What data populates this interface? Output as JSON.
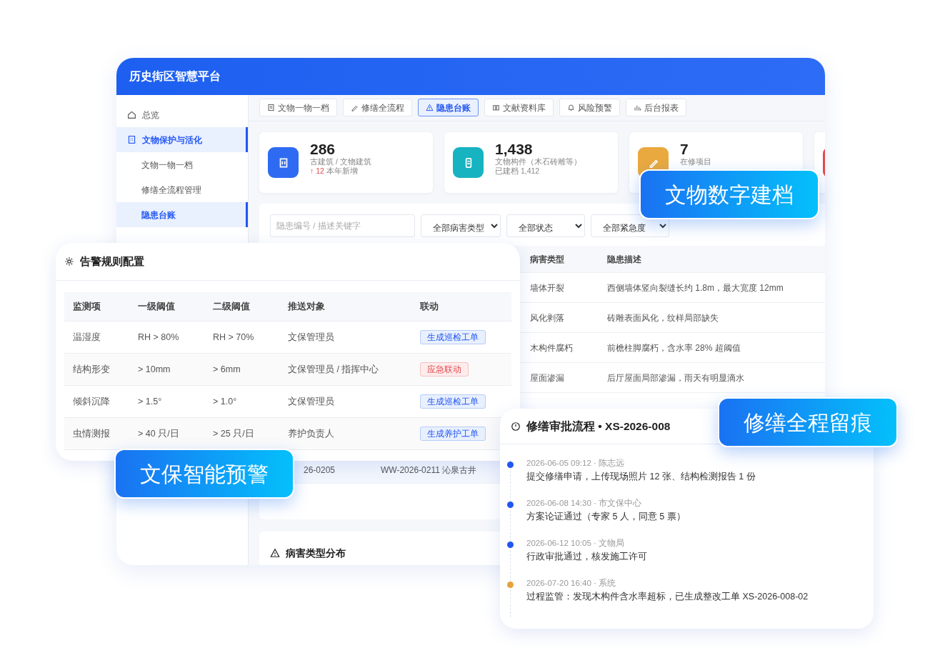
{
  "window": {
    "title": "历史街区智慧平台"
  },
  "sidebar": {
    "items": [
      {
        "label": "总览",
        "kind": "top",
        "selected": false
      },
      {
        "label": "文物保护与活化",
        "kind": "group",
        "selected": true
      },
      {
        "label": "文物一物一档",
        "kind": "sub",
        "selected": false
      },
      {
        "label": "修缮全流程管理",
        "kind": "sub",
        "selected": false
      },
      {
        "label": "隐患台账",
        "kind": "sub",
        "selected": true
      }
    ]
  },
  "tabs": [
    {
      "label": "文物一物一档",
      "selected": false
    },
    {
      "label": "修缮全流程",
      "selected": false
    },
    {
      "label": "隐患台账",
      "selected": true
    },
    {
      "label": "文献资料库",
      "selected": false
    },
    {
      "label": "风险预警",
      "selected": false
    },
    {
      "label": "后台报表",
      "selected": false
    }
  ],
  "stats": [
    {
      "value": "286",
      "label": "古建筑 / 文物建筑",
      "delta": "↑ 12",
      "note": "本年新增",
      "color": "#2f6bf2"
    },
    {
      "value": "1,438",
      "label": "文物构件（木石砖雕等）",
      "note": "已建档 1,412",
      "color": "#17b3c1"
    },
    {
      "value": "7",
      "label": "在修项目",
      "color": "#e9a93f"
    },
    {
      "color": "#e5484d"
    }
  ],
  "filters": {
    "search": {
      "placeholder": "隐患编号 / 描述关键字"
    },
    "selects": [
      "全部病害类型",
      "全部状态",
      "全部紧急度"
    ]
  },
  "hazard_table": {
    "columns": [
      "病害类型",
      "隐患描述"
    ],
    "rows": [
      [
        "墙体开裂",
        "西侧墙体竖向裂缝长约 1.8m，最大宽度 12mm"
      ],
      [
        "风化剥落",
        "砖雕表面风化，纹样局部缺失"
      ],
      [
        "木构件腐朽",
        "前檐柱脚腐朽，含水率 28% 超阈值"
      ],
      [
        "屋面渗漏",
        "后厅屋面局部渗漏，雨天有明显滴水"
      ]
    ]
  },
  "related_row": [
    "26-0205",
    "WW-2026-0211 沁泉古井"
  ],
  "distribution_card": {
    "title": "病害类型分布"
  },
  "alert_rules": {
    "title": "告警规则配置",
    "columns": [
      "监测项",
      "一级阈值",
      "二级阈值",
      "推送对象",
      "联动"
    ],
    "rows": [
      {
        "cells": [
          "温湿度",
          "RH > 80%",
          "RH > 70%",
          "文保管理员"
        ],
        "action": "生成巡检工单",
        "kind": "info"
      },
      {
        "cells": [
          "结构形变",
          "> 10mm",
          "> 6mm",
          "文保管理员 / 指挥中心"
        ],
        "action": "应急联动",
        "kind": "danger"
      },
      {
        "cells": [
          "倾斜沉降",
          "> 1.5°",
          "> 1.0°",
          "文保管理员"
        ],
        "action": "生成巡检工单",
        "kind": "info"
      },
      {
        "cells": [
          "虫情测报",
          "> 40 只/日",
          "> 25 只/日",
          "养护负责人"
        ],
        "action": "生成养护工单",
        "kind": "info"
      }
    ]
  },
  "approval": {
    "title": "修缮审批流程 • XS-2026-008",
    "items": [
      {
        "meta": "2026-06-05 09:12 · 陈志远",
        "text": "提交修缮申请，上传现场照片 12 张、结构检测报告 1 份",
        "color": "#2156f3"
      },
      {
        "meta": "2026-06-08 14:30 · 市文保中心",
        "text": "方案论证通过（专家 5 人，同意 5 票）",
        "color": "#2156f3"
      },
      {
        "meta": "2026-06-12 10:05 · 文物局",
        "text": "行政审批通过，核发施工许可",
        "color": "#2156f3"
      },
      {
        "meta": "2026-07-20 16:40 · 系统",
        "text": "过程监管：发现木构件含水率超标，已生成整改工单 XS-2026-008-02",
        "color": "#e6a23c"
      }
    ]
  },
  "callouts": [
    "文物数字建档",
    "文保智能预警",
    "修缮全程留痕"
  ]
}
